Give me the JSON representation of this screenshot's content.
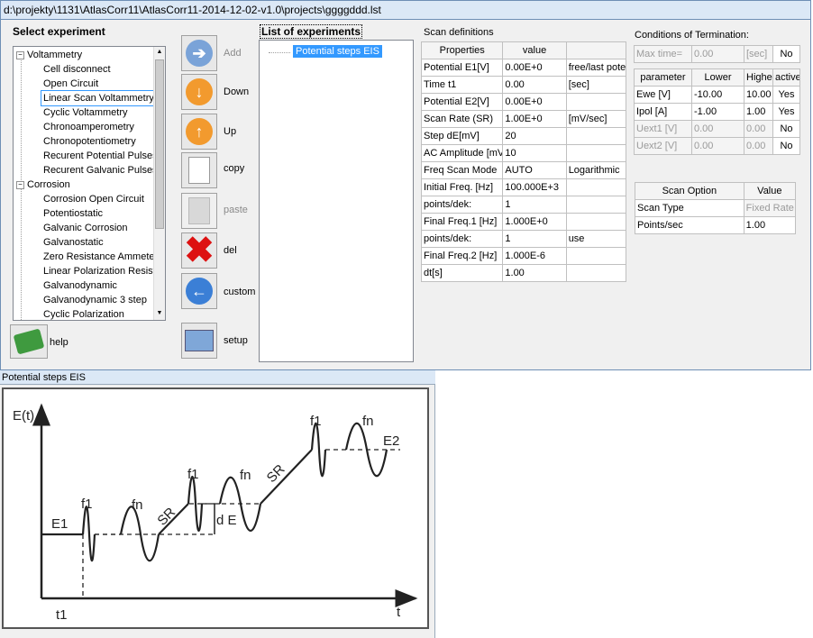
{
  "window_title": "d:\\projekty\\1131\\AtlasCorr11\\AtlasCorr11-2014-12-02-v1.0\\projects\\ggggddd.lst",
  "select_experiment": {
    "label": "Select experiment",
    "groups": [
      {
        "label": "Voltammetry",
        "items": [
          "Cell disconnect",
          "Open Circuit",
          "Linear Scan Voltammetry",
          "Cyclic Voltammetry",
          "Chronoamperometry",
          "Chronopotentiometry",
          "Recurent Potential Pulses",
          "Recurent Galvanic Pulses"
        ]
      },
      {
        "label": "Corrosion",
        "items": [
          "Corrosion Open Circuit",
          "Potentiostatic",
          "Galvanic Corrosion",
          "Galvanostatic",
          "Zero Resistance Ammeter",
          "Linear Polarization Resista",
          "Galvanodynamic",
          "Galvanodynamic 3 step",
          "Cyclic Polarization"
        ]
      }
    ],
    "selected": "Linear Scan Voltammetry"
  },
  "toolbar": {
    "add": "Add",
    "down": "Down",
    "up": "Up",
    "copy": "copy",
    "paste": "paste",
    "del": "del",
    "custom": "custom",
    "setup": "setup",
    "help": "help"
  },
  "experiments": {
    "label": "List of experiments",
    "items": [
      "Potential steps EIS"
    ]
  },
  "scan_definitions": {
    "label": "Scan definitions",
    "headers": [
      "Properties",
      "value",
      ""
    ],
    "rows": [
      [
        "Potential E1[V]",
        "0.00E+0",
        "free/last poten"
      ],
      [
        "Time t1",
        "0.00",
        "[sec]"
      ],
      [
        "Potential E2[V]",
        "0.00E+0",
        ""
      ],
      [
        "Scan Rate (SR)",
        "1.00E+0",
        "[mV/sec]"
      ],
      [
        "Step dE[mV]",
        "20",
        ""
      ],
      [
        "AC Amplitude [mV]",
        "10",
        ""
      ],
      [
        "Freq Scan Mode",
        "AUTO",
        "Logarithmic"
      ],
      [
        "Initial Freq. [Hz]",
        "100.000E+3",
        ""
      ],
      [
        "points/dek:",
        "1",
        ""
      ],
      [
        "Final Freq.1 [Hz]",
        "1.000E+0",
        ""
      ],
      [
        "points/dek:",
        "1",
        "use"
      ],
      [
        "Final Freq.2 [Hz]",
        "1.000E-6",
        ""
      ],
      [
        "dt[s]",
        "1.00",
        ""
      ]
    ]
  },
  "termination": {
    "label": "Conditions of Termination:",
    "max_time": {
      "label": "Max time=",
      "value": "0.00",
      "unit": "[sec]",
      "active": "No"
    },
    "headers": [
      "parameter",
      "Lower",
      "Higher",
      "active"
    ],
    "rows": [
      [
        "Ewe [V]",
        "-10.00",
        "10.00",
        "Yes"
      ],
      [
        "Ipol [A]",
        "-1.00",
        "1.00",
        "Yes"
      ],
      [
        "Uext1 [V]",
        "0.00",
        "0.00",
        "No"
      ],
      [
        "Uext2 [V]",
        "0.00",
        "0.00",
        "No"
      ]
    ]
  },
  "scan_option": {
    "headers": [
      "Scan Option",
      "Value"
    ],
    "rows": [
      [
        "Scan Type",
        "Fixed Rate"
      ],
      [
        "Points/sec",
        "1.00"
      ]
    ]
  },
  "preview": {
    "title": "Potential steps EIS",
    "labels": {
      "y_axis": "E(t)",
      "x_axis": "t",
      "t1": "t1",
      "e1": "E1",
      "e2": "E2",
      "f1a": "f1",
      "fna": "fn",
      "sr1": "SR",
      "de": "d E",
      "f1b": "f1",
      "fnb": "fn",
      "sr2": "SR",
      "f1c": "f1",
      "fnc": "fn"
    }
  }
}
